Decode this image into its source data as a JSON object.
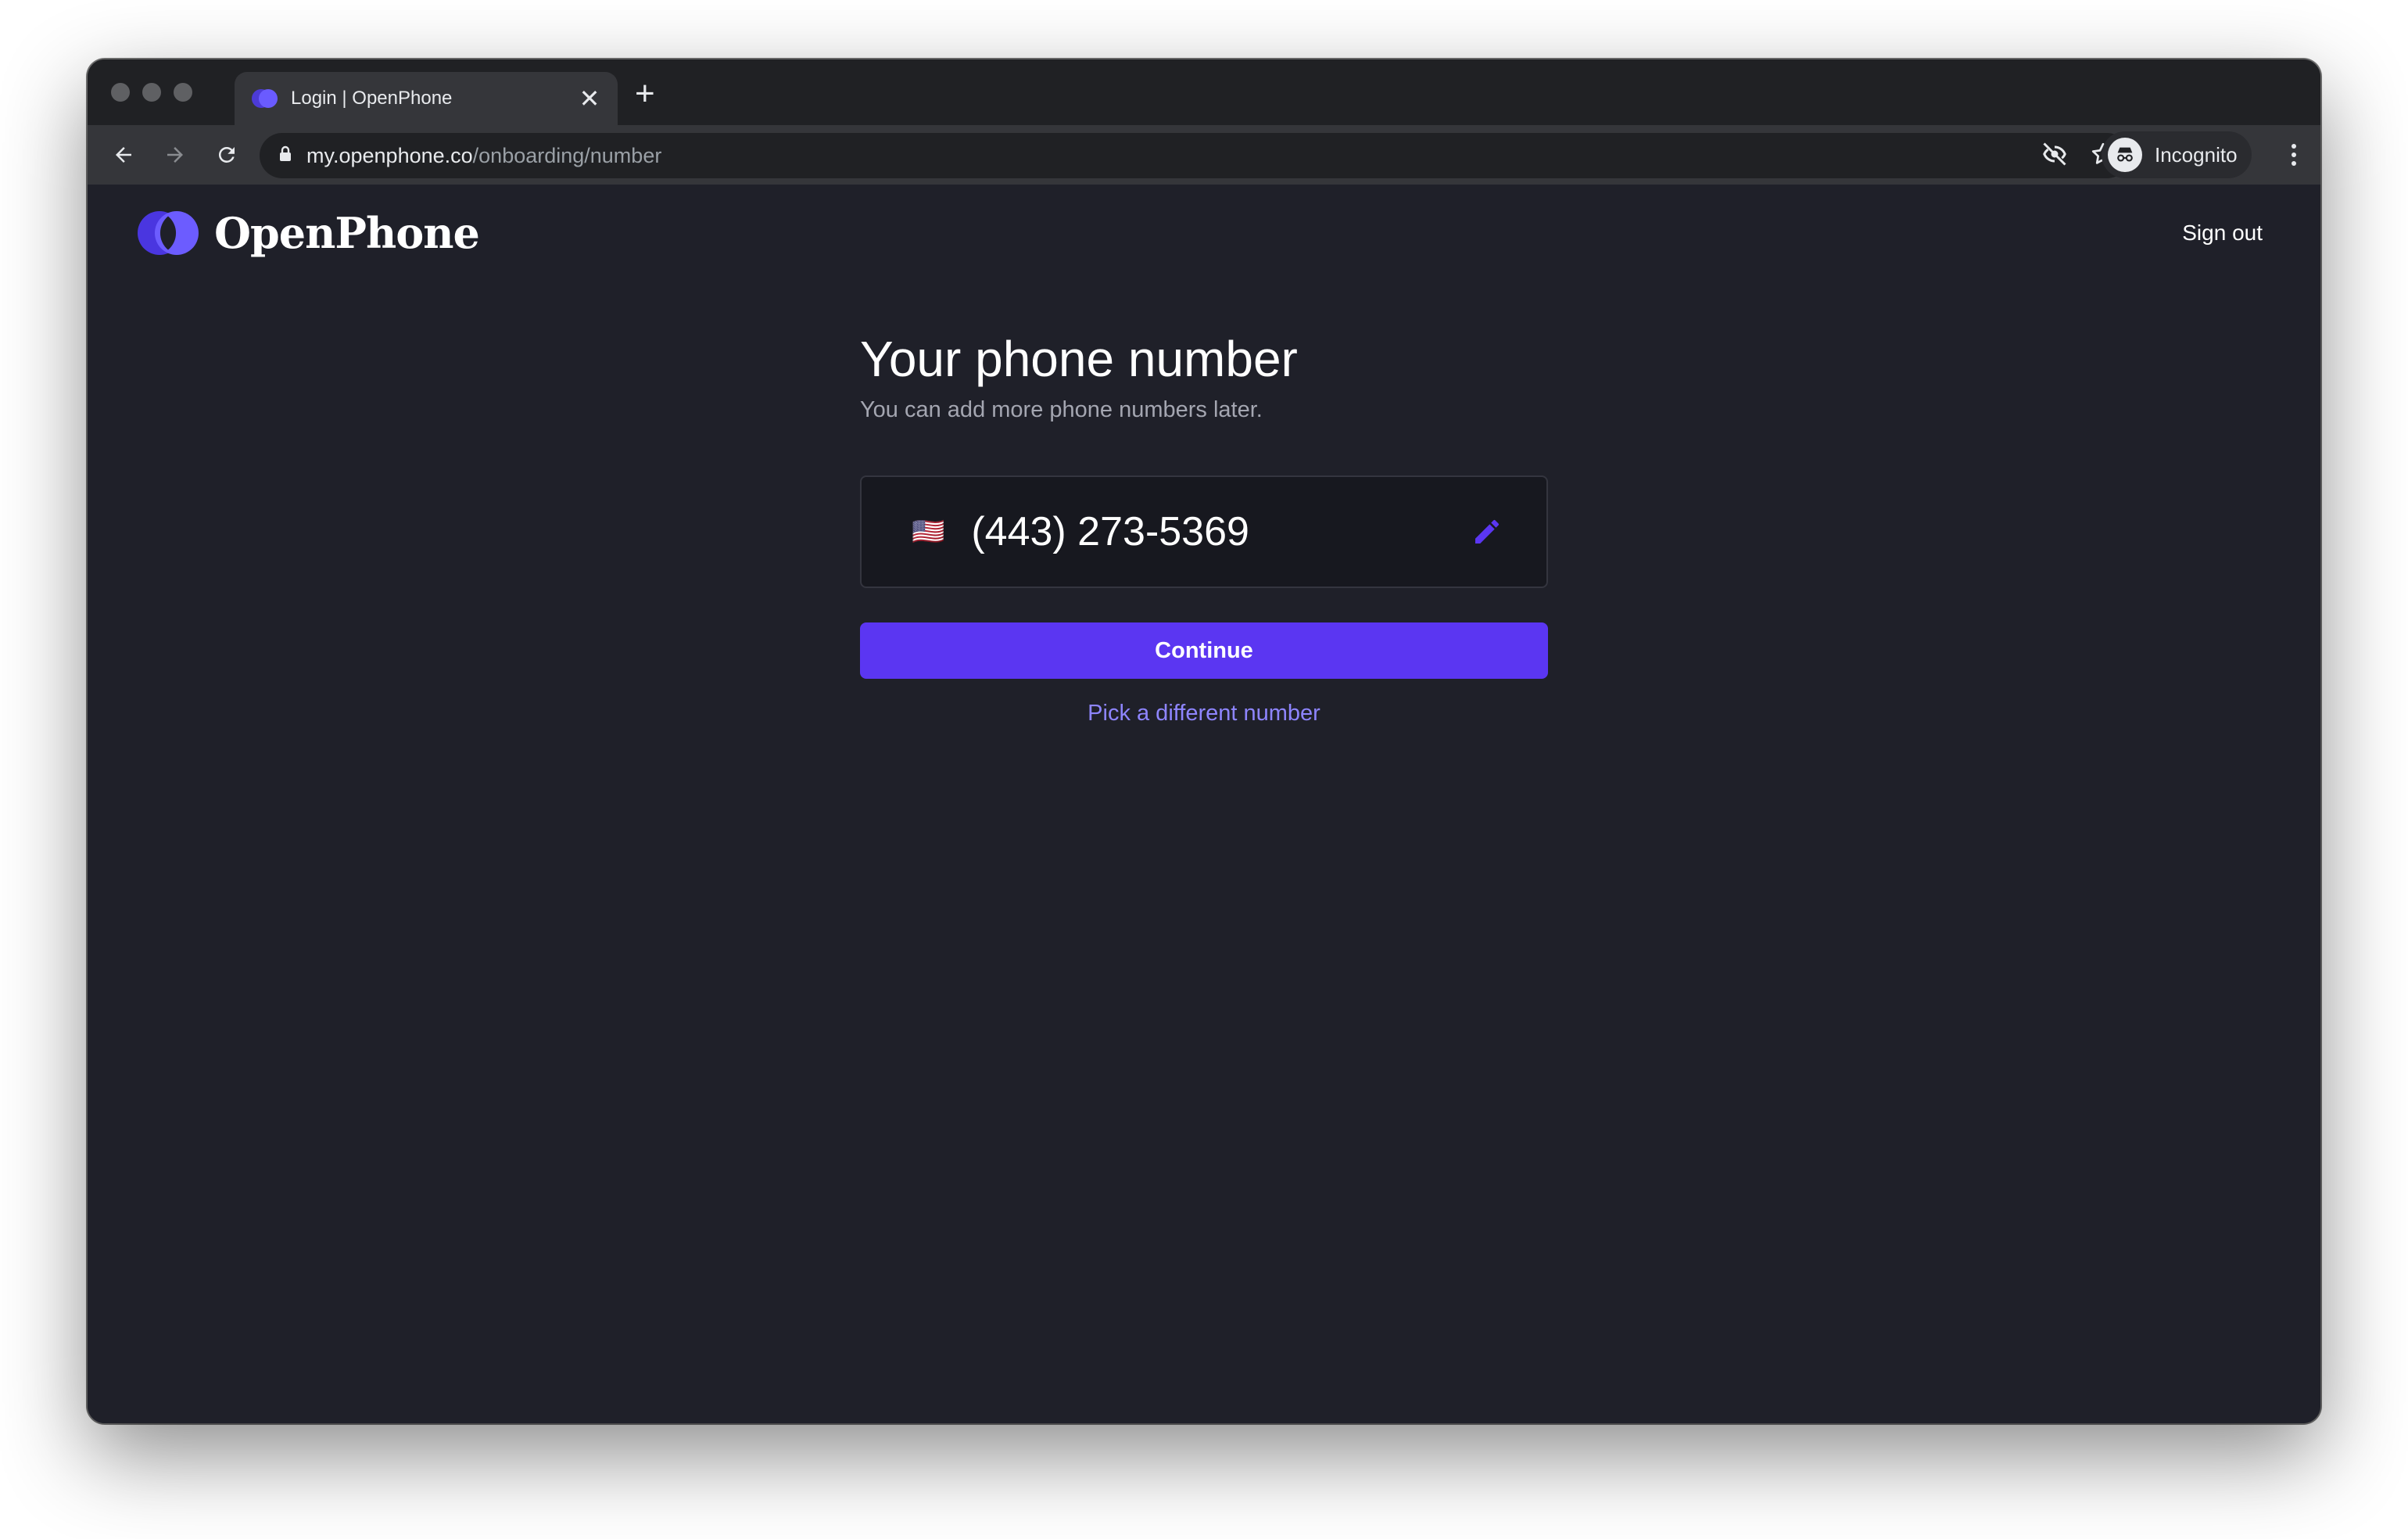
{
  "browser": {
    "tab": {
      "title": "Login | OpenPhone",
      "close": "✕"
    },
    "new_tab": "+",
    "url": {
      "host": "my.openphone.co",
      "path": "/onboarding/number"
    },
    "profile_label": "Incognito"
  },
  "header": {
    "brand": "OpenPhone",
    "sign_out": "Sign out"
  },
  "main": {
    "title": "Your phone number",
    "subtitle": "You can add more phone numbers later.",
    "flag": "🇺🇸",
    "phone_number": "(443) 273-5369",
    "continue_label": "Continue",
    "pick_label": "Pick a different number"
  },
  "colors": {
    "accent": "#5b36f2",
    "link": "#8e85ff",
    "background": "#1f2029"
  }
}
